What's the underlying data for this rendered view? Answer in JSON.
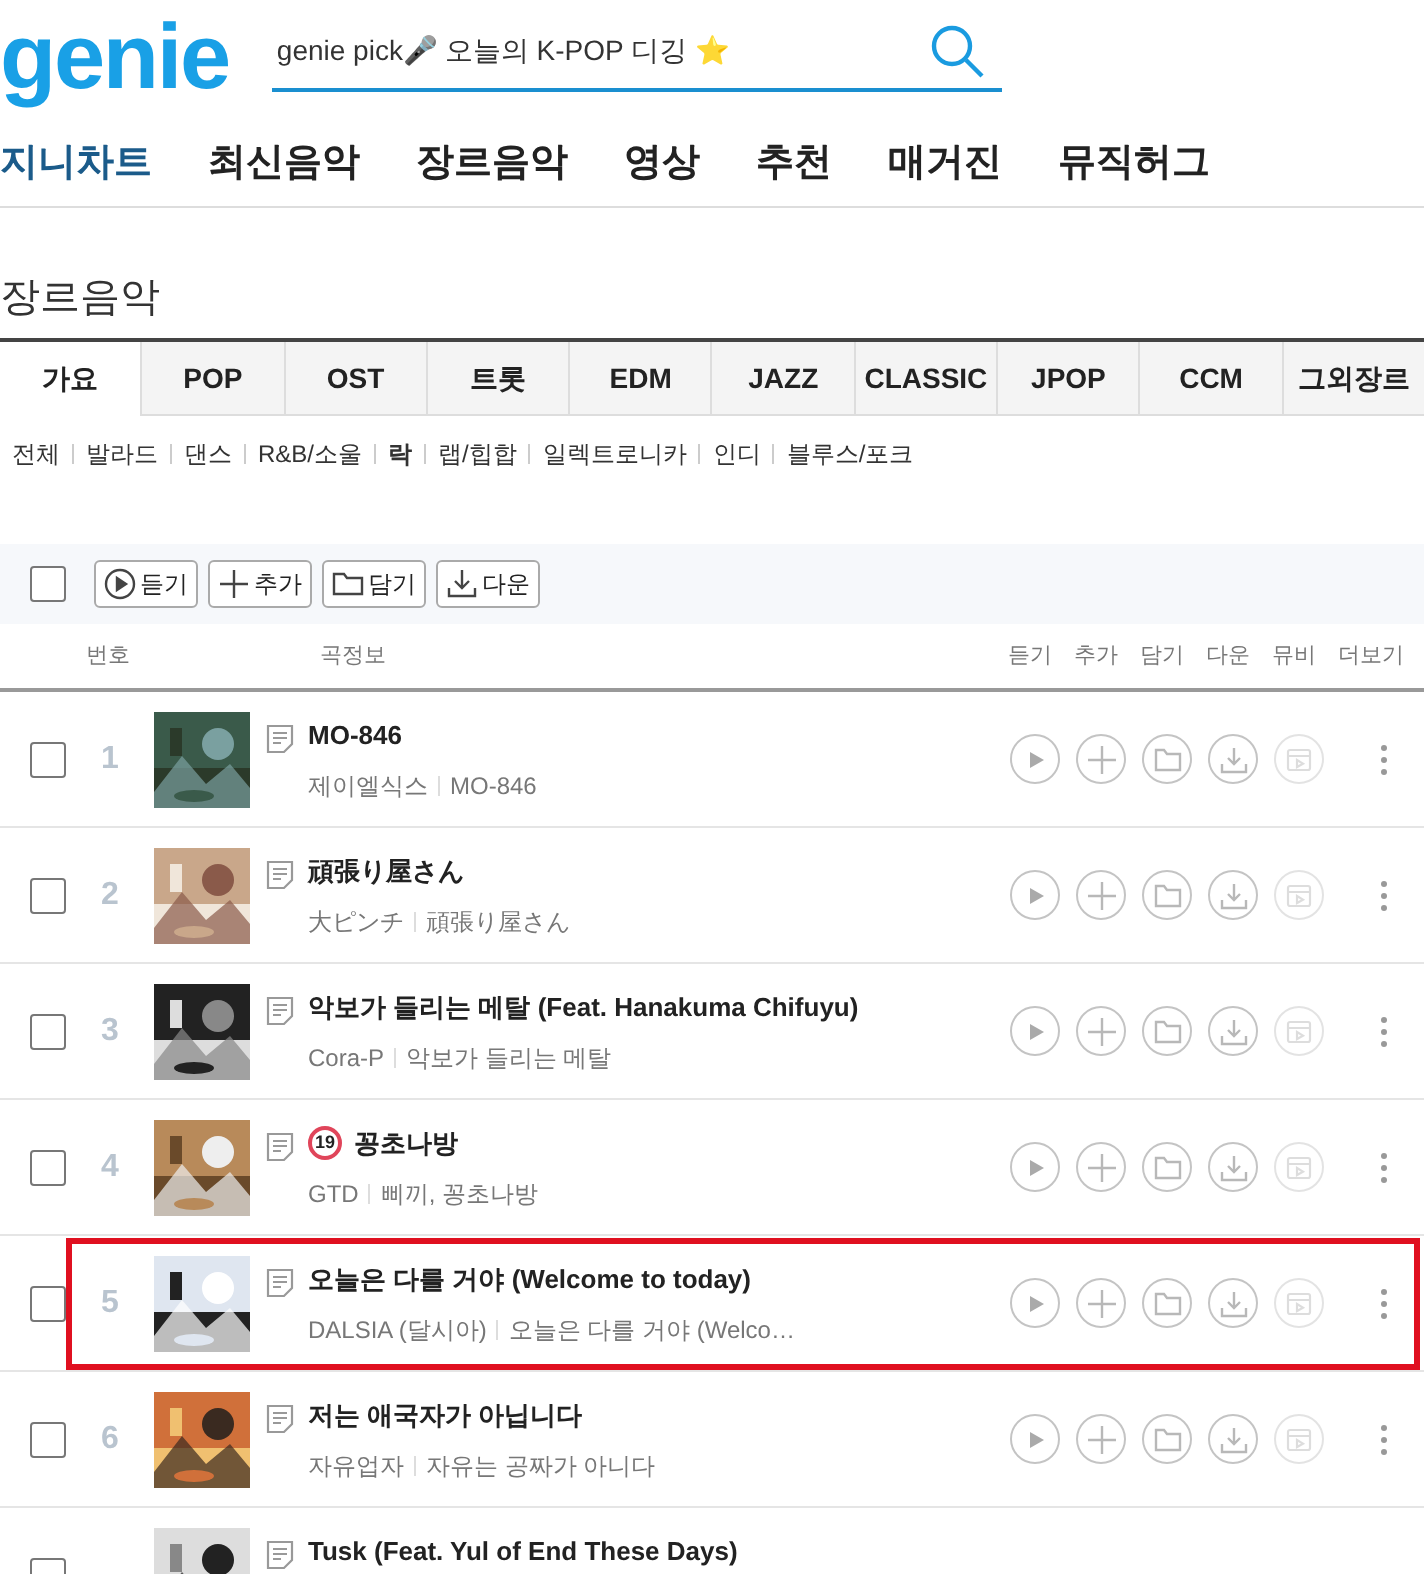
{
  "logo": "genie",
  "search": {
    "value": "genie pick🎤 오늘의 K-POP 디깅 ⭐"
  },
  "nav": [
    {
      "label": "지니차트",
      "selected": true
    },
    {
      "label": "최신음악",
      "selected": false
    },
    {
      "label": "장르음악",
      "selected": false
    },
    {
      "label": "영상",
      "selected": false
    },
    {
      "label": "추천",
      "selected": false
    },
    {
      "label": "매거진",
      "selected": false
    },
    {
      "label": "뮤직허그",
      "selected": false
    }
  ],
  "page_title": "장르음악",
  "tabs": [
    {
      "label": "가요",
      "selected": true
    },
    {
      "label": "POP",
      "selected": false
    },
    {
      "label": "OST",
      "selected": false
    },
    {
      "label": "트롯",
      "selected": false
    },
    {
      "label": "EDM",
      "selected": false
    },
    {
      "label": "JAZZ",
      "selected": false
    },
    {
      "label": "CLASSIC",
      "selected": false
    },
    {
      "label": "JPOP",
      "selected": false
    },
    {
      "label": "CCM",
      "selected": false
    },
    {
      "label": "그외장르",
      "selected": false
    }
  ],
  "subgenres": [
    {
      "label": "전체",
      "selected": false
    },
    {
      "label": "발라드",
      "selected": false
    },
    {
      "label": "댄스",
      "selected": false
    },
    {
      "label": "R&B/소울",
      "selected": false
    },
    {
      "label": "락",
      "selected": true
    },
    {
      "label": "랩/힙합",
      "selected": false
    },
    {
      "label": "일렉트로니카",
      "selected": false
    },
    {
      "label": "인디",
      "selected": false
    },
    {
      "label": "블루스/포크",
      "selected": false
    }
  ],
  "toolbar": {
    "select_all_checked": false,
    "buttons": [
      {
        "kind": "play",
        "label": "듣기"
      },
      {
        "kind": "add",
        "label": "추가"
      },
      {
        "kind": "folder",
        "label": "담기"
      },
      {
        "kind": "download",
        "label": "다운"
      }
    ]
  },
  "columns": {
    "number": "번호",
    "info": "곡정보",
    "actions": [
      "듣기",
      "추가",
      "담기",
      "다운",
      "뮤비",
      "더보기"
    ]
  },
  "rows": [
    {
      "number": "1",
      "title": "MO-846",
      "artist": "제이엘식스",
      "album": "MO-846",
      "checked": false,
      "highlighted": false
    },
    {
      "number": "2",
      "title": "頑張り屋さん",
      "artist": "大ピンチ",
      "album": "頑張り屋さん",
      "checked": false,
      "highlighted": false
    },
    {
      "number": "3",
      "title": "악보가 들리는 메탈 (Feat. Hanakuma Chifuyu)",
      "artist": "Cora-P",
      "album": "악보가 들리는 메탈",
      "checked": false,
      "highlighted": false
    },
    {
      "number": "4",
      "badge": "19",
      "title": "꽁초나방",
      "artist": "GTD",
      "album": "삐끼, 꽁초나방",
      "checked": false,
      "highlighted": false
    },
    {
      "number": "5",
      "title": "오늘은 다를 거야 (Welcome to today)",
      "artist": "DALSIA (달시아)",
      "album": "오늘은 다를 거야 (Welco…",
      "checked": false,
      "highlighted": true
    },
    {
      "number": "6",
      "title": "저는 애국자가 아닙니다",
      "artist": "자유업자",
      "album": "자유는 공짜가 아니다",
      "checked": false,
      "highlighted": false
    },
    {
      "title": "Tusk (Feat. Yul of End These Days)",
      "checked": false,
      "highlighted": false
    }
  ]
}
